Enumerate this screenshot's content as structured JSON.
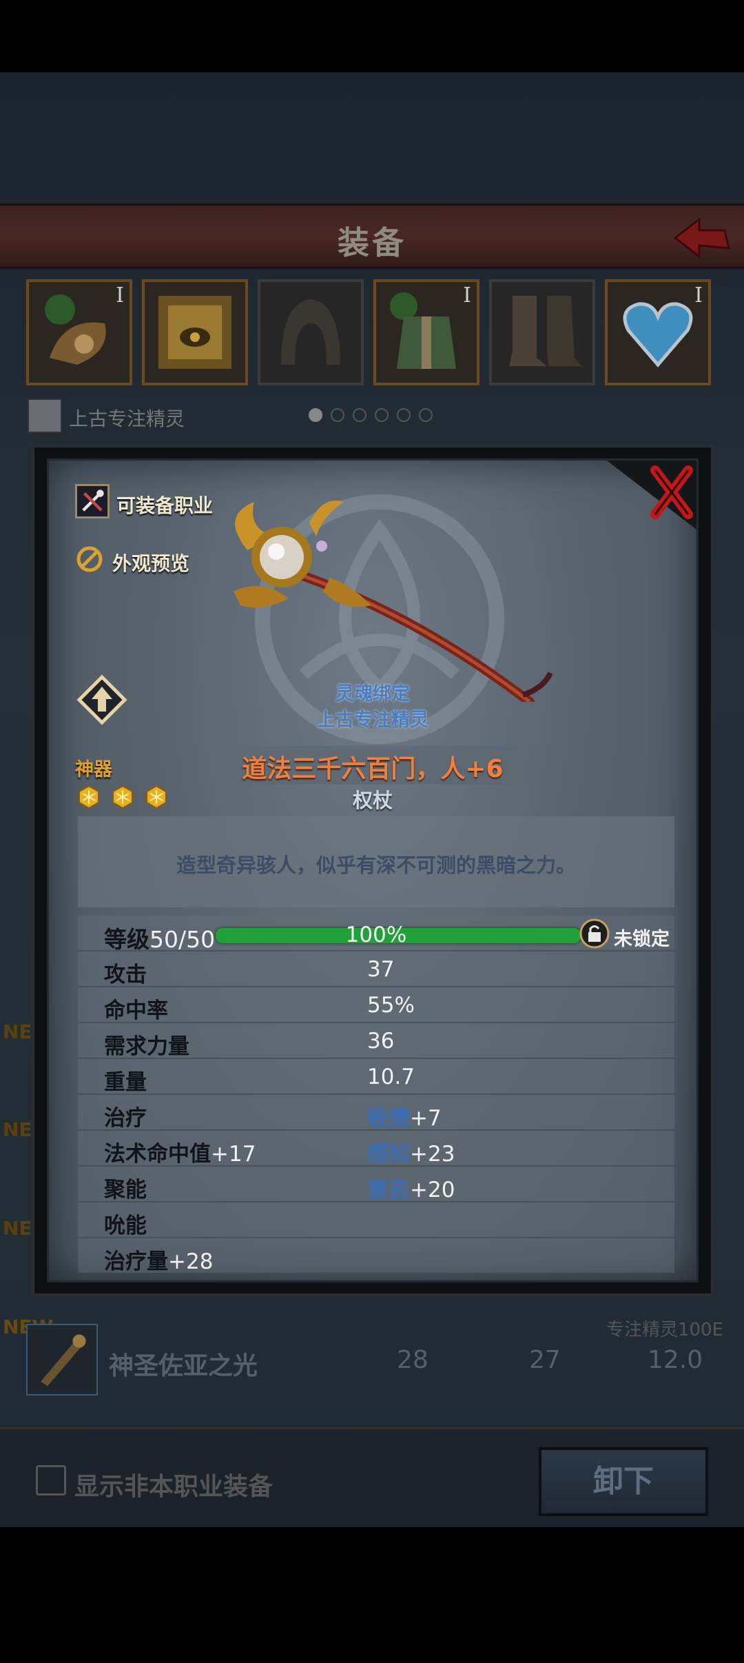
{
  "screen": {
    "title": "装备",
    "owner_name": "上古专注精灵",
    "slot_tier_marks": [
      "I",
      "I",
      "I"
    ],
    "show_nonclass_label": "显示非本职业装备",
    "unequip_label": "卸下",
    "new_badge": "NEW",
    "list_row": {
      "new": "NEW",
      "class_req": "专注精灵100E",
      "name": "神圣佐亚之光",
      "col1": "28",
      "col2": "27",
      "col3": "12.0"
    }
  },
  "popup": {
    "class_button": "可装备职业",
    "preview_button": "外观预览",
    "soulbound_line1": "灵魂绑定",
    "soulbound_line2": "上古专注精灵",
    "rarity": "神器",
    "item_name": "道法三千六百门，人+6",
    "item_type": "权杖",
    "star_count": 3,
    "description": "造型奇异骇人，似乎有深不可测的黑暗之力。",
    "level_label": "等级",
    "level_value": "50/50",
    "level_progress": "100%",
    "lock_label": "未锁定",
    "stats": [
      {
        "label": "攻击",
        "label_plus": "",
        "value": "37",
        "value_plus": "",
        "blue": false
      },
      {
        "label": "命中率",
        "label_plus": "",
        "value": "55%",
        "value_plus": "",
        "blue": false
      },
      {
        "label": "需求力量",
        "label_plus": "",
        "value": "36",
        "value_plus": "",
        "blue": false
      },
      {
        "label": "重量",
        "label_plus": "",
        "value": "10.7",
        "value_plus": "",
        "blue": false
      },
      {
        "label": "治疗",
        "label_plus": "",
        "value": "敏捷",
        "value_plus": "+7",
        "blue": true
      },
      {
        "label": "法术命中值",
        "label_plus": "+17",
        "value": "感知",
        "value_plus": "+23",
        "blue": true
      },
      {
        "label": "聚能",
        "label_plus": "",
        "value": "意志",
        "value_plus": "+20",
        "blue": true
      },
      {
        "label": "吮能",
        "label_plus": "",
        "value": "",
        "value_plus": "",
        "blue": false
      },
      {
        "label": "治疗量",
        "label_plus": "+28",
        "value": "",
        "value_plus": "",
        "blue": false
      }
    ]
  },
  "colors": {
    "rarity": "#e0a030",
    "item_name": "#f08040",
    "soulbound": "#4a7cc0",
    "level_bar": "#22a03a"
  },
  "icons": [
    "back-arrow-icon",
    "close-x-icon",
    "crossed-tools-icon",
    "preview-icon",
    "upgrade-arrow-icon",
    "gold-star-icon",
    "lock-icon",
    "staff-illustration"
  ]
}
